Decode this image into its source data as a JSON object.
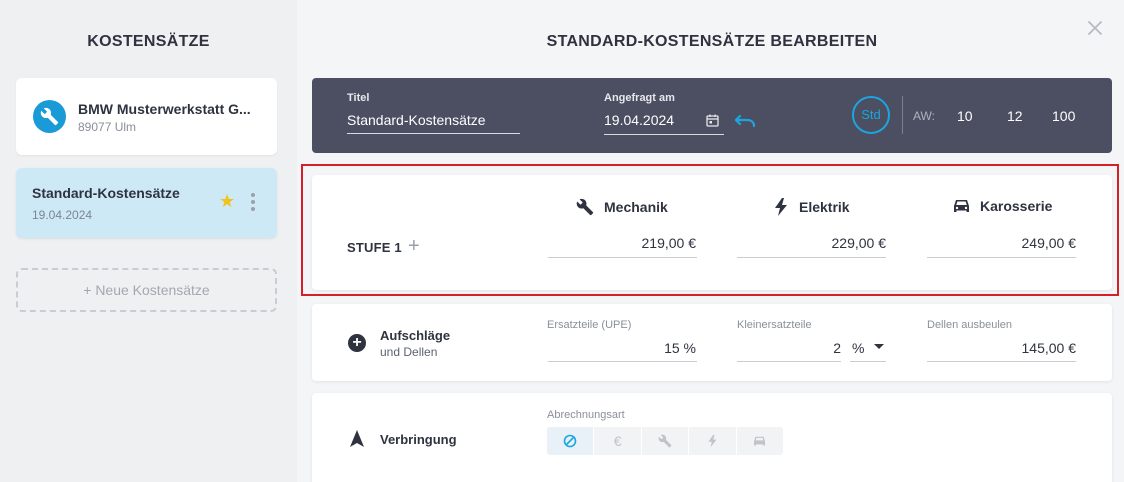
{
  "sidebar": {
    "title": "KOSTENSÄTZE",
    "workshop": {
      "name": "BMW Musterwerkstatt G...",
      "city": "89077 Ulm"
    },
    "selected": {
      "title": "Standard-Kostensätze",
      "date": "19.04.2024"
    },
    "new_label": "+ Neue Kostensätze"
  },
  "dialog": {
    "title": "STANDARD-KOSTENSÄTZE BEARBEITEN",
    "header": {
      "titel_label": "Titel",
      "titel_value": "Standard-Kostensätze",
      "date_label": "Angefragt am",
      "date_value": "19.04.2024",
      "std_label": "Std",
      "aw_label": "AW:",
      "aw_values": [
        "10",
        "12",
        "100"
      ]
    },
    "stufe": {
      "label": "STUFE 1",
      "columns": [
        {
          "name": "Mechanik",
          "price": "219,00 €",
          "icon": "wrench-icon"
        },
        {
          "name": "Elektrik",
          "price": "229,00 €",
          "icon": "lightning-icon"
        },
        {
          "name": "Karosserie",
          "price": "249,00 €",
          "icon": "car-icon"
        }
      ]
    },
    "aufschlaege": {
      "title": "Aufschläge",
      "subtitle": "und Dellen",
      "ersatzteile_label": "Ersatzteile (UPE)",
      "ersatzteile_value": "15 %",
      "kleinersatzteile_label": "Kleinersatzteile",
      "kleinersatzteile_value": "2",
      "kleinersatzteile_unit": "%",
      "dellen_label": "Dellen ausbeulen",
      "dellen_value": "145,00 €"
    },
    "verbringung": {
      "title": "Verbringung",
      "abrechnungsart_label": "Abrechnungsart"
    }
  },
  "colors": {
    "accent": "#1ba6e0",
    "header_bg": "#4b4f61",
    "highlight": "#d61f26"
  }
}
